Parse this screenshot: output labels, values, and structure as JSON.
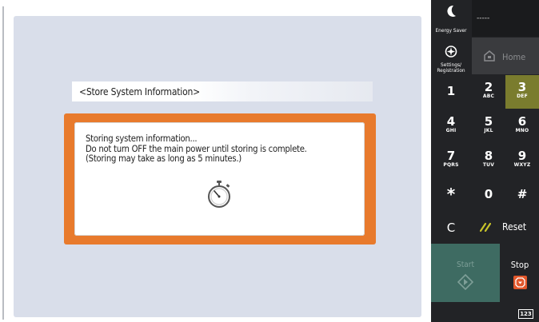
{
  "screen": {
    "info_bar_label": "<Store System Information>",
    "dialog": {
      "lines": [
        "Storing system information...",
        "Do not turn OFF the main power until storing is complete.",
        "(Storing may take as long as 5 minutes.)"
      ],
      "icon": "stopwatch-icon",
      "accent_color": "#e87a2c"
    }
  },
  "panel": {
    "energy_saver_label": "Energy Saver",
    "status_text": "-----",
    "settings_label_1": "Settings/",
    "settings_label_2": "Registration",
    "home_label": "Home",
    "keys": [
      {
        "num": "1",
        "sub": ""
      },
      {
        "num": "2",
        "sub": "ABC"
      },
      {
        "num": "3",
        "sub": "DEF"
      },
      {
        "num": "4",
        "sub": "GHI"
      },
      {
        "num": "5",
        "sub": "JKL"
      },
      {
        "num": "6",
        "sub": "MNO"
      },
      {
        "num": "7",
        "sub": "PQRS"
      },
      {
        "num": "8",
        "sub": "TUV"
      },
      {
        "num": "9",
        "sub": "WXYZ"
      },
      {
        "num": "*",
        "sub": ""
      },
      {
        "num": "0",
        "sub": ""
      },
      {
        "num": "#",
        "sub": ""
      }
    ],
    "clear_label": "C",
    "reset_label": "Reset",
    "start_label": "Start",
    "stop_label": "Stop",
    "mode_badge": "123",
    "colors": {
      "panel_bg": "#222326",
      "key_3_bg": "#7a7c2e",
      "start_bg": "#3e6b62",
      "stop_icon": "#e2572b",
      "reset_icon": "#c8c42a"
    }
  }
}
